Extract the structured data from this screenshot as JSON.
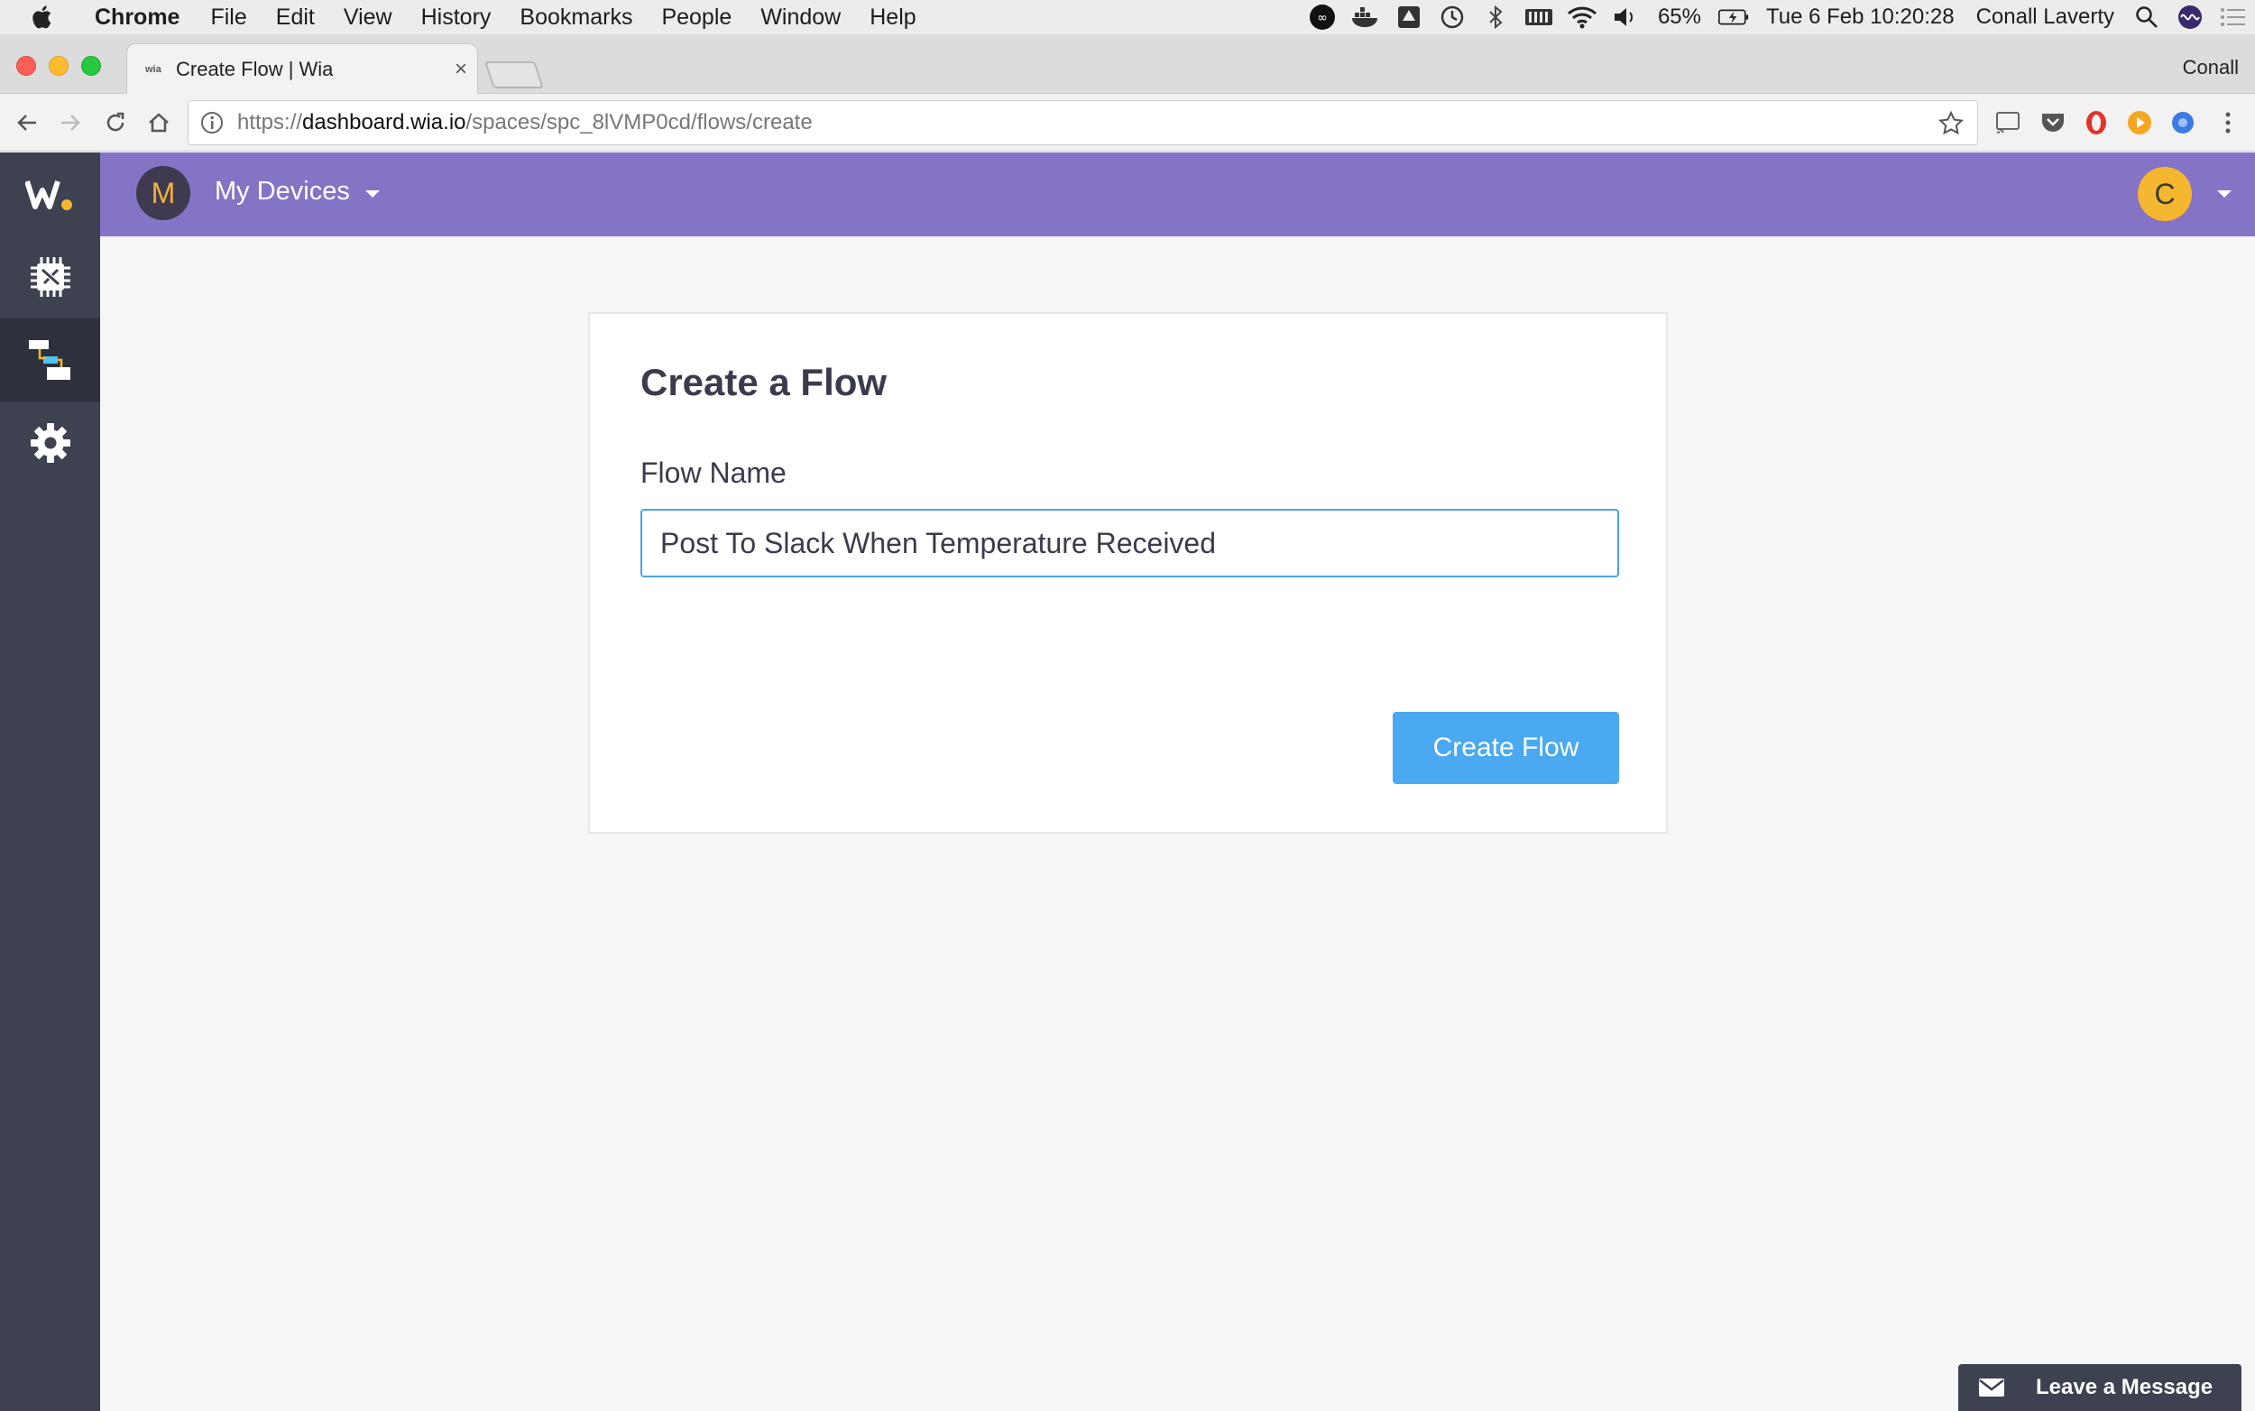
{
  "menubar": {
    "app_name": "Chrome",
    "items": [
      "File",
      "Edit",
      "View",
      "History",
      "Bookmarks",
      "People",
      "Window",
      "Help"
    ],
    "battery": "65%",
    "datetime": "Tue 6 Feb  10:20:28",
    "user": "Conall Laverty",
    "status_icons": [
      "infinity-icon",
      "docker-icon",
      "drive-icon",
      "time-machine-icon",
      "bluetooth-icon",
      "battery-bar-icon",
      "wifi-icon",
      "volume-icon"
    ]
  },
  "browser": {
    "tab_title": "Create Flow | Wia",
    "tab_favicon_text": "wia",
    "profile_name": "Conall",
    "url_prefix": "https://",
    "url_host": "dashboard.wia.io",
    "url_path": "/spaces/spc_8lVMP0cd/flows/create",
    "extensions": [
      "cast-icon",
      "pocket-icon",
      "opera-icon",
      "play-icon",
      "blue-ext-icon",
      "menu-dots-icon"
    ]
  },
  "app": {
    "space_avatar_letter": "M",
    "space_name": "My Devices",
    "user_avatar_letter": "C",
    "sidebar": [
      "logo",
      "devices",
      "flows",
      "settings"
    ],
    "active_sidebar": "flows",
    "accent_color": "#8573c6",
    "sidebar_color": "#3d4150"
  },
  "form": {
    "title": "Create a Flow",
    "field_label": "Flow Name",
    "flow_name_value": "Post To Slack When Temperature Received",
    "submit_label": "Create Flow",
    "button_color": "#4aa9f0"
  },
  "chat_widget": {
    "label": "Leave a Message"
  }
}
